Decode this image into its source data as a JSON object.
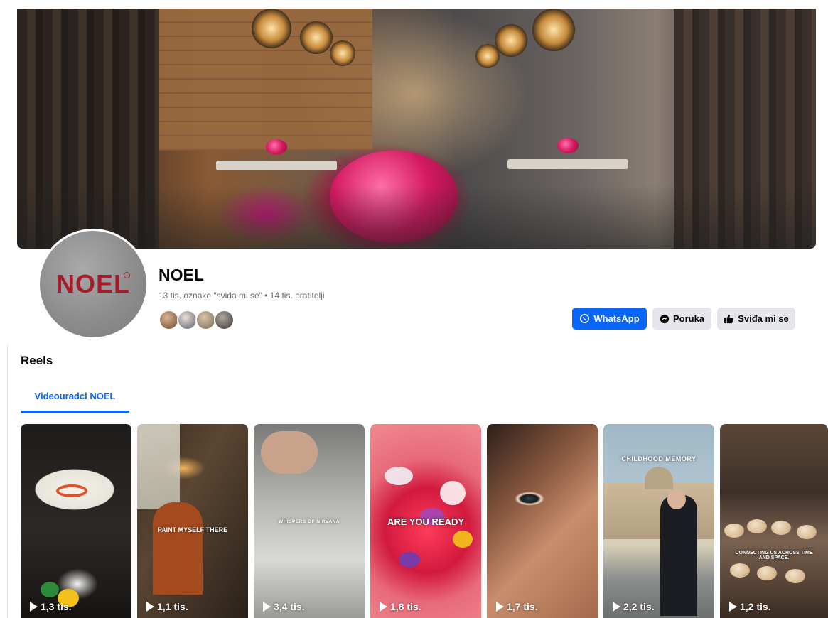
{
  "page": {
    "name": "NOEL",
    "stats": "13 tis. oznake \"sviđa mi se\" • 14 tis. pratitelji",
    "avatar_logo": "NOEL"
  },
  "actions": {
    "whatsapp_label": "WhatsApp",
    "message_label": "Poruka",
    "like_label": "Sviđa mi se"
  },
  "reels": {
    "title": "Reels",
    "tab_label": "Videouradci NOEL",
    "items": [
      {
        "views": "1,3 tis.",
        "overlay": ""
      },
      {
        "views": "1,1 tis.",
        "overlay": "PAINT MYSELF THERE"
      },
      {
        "views": "3,4 tis.",
        "overlay": "WHISPERS OF NIRVANA"
      },
      {
        "views": "1,8 tis.",
        "overlay": "ARE YOU READY"
      },
      {
        "views": "1,7 tis.",
        "overlay": ""
      },
      {
        "views": "2,2 tis.",
        "overlay": "CHILDHOOD MEMORY"
      },
      {
        "views": "1,2 tis.",
        "overlay": "CONNECTING US ACROSS TIME AND SPACE."
      }
    ]
  },
  "colors": {
    "accent": "#0866ff",
    "secondary_button": "#e4e6eb",
    "brand_logo": "#a51d2d"
  }
}
